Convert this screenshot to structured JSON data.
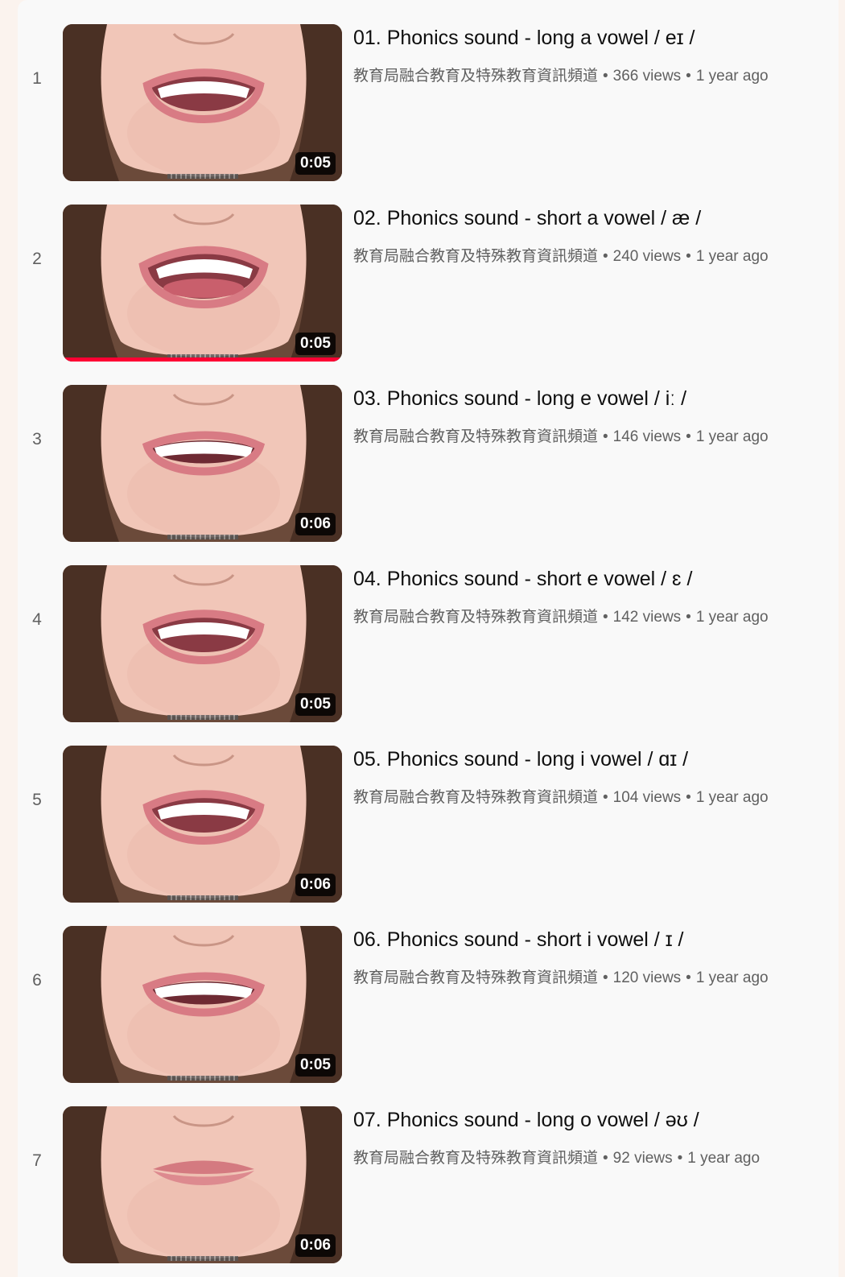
{
  "playlist": {
    "colors": {
      "progress": "#ff0033",
      "title": "#0f0f0f",
      "meta": "#606060"
    },
    "items": [
      {
        "index": "1",
        "title": "01. Phonics sound - long a vowel  / eɪ /",
        "channel": "教育局融合教育及特殊教育資訊頻道",
        "views": "366 views",
        "age": "1 year ago",
        "duration": "0:05",
        "watched_fraction": 0,
        "mouth": "open"
      },
      {
        "index": "2",
        "title": "02. Phonics sound - short a vowel  / æ  /",
        "channel": "教育局融合教育及特殊教育資訊頻道",
        "views": "240 views",
        "age": "1 year ago",
        "duration": "0:05",
        "watched_fraction": 1,
        "mouth": "wide"
      },
      {
        "index": "3",
        "title": "03. Phonics sound - long e vowel  / iː /",
        "channel": "教育局融合教育及特殊教育資訊頻道",
        "views": "146 views",
        "age": "1 year ago",
        "duration": "0:06",
        "watched_fraction": 0,
        "mouth": "smile"
      },
      {
        "index": "4",
        "title": "04. Phonics sound - short e vowel  / ɛ /",
        "channel": "教育局融合教育及特殊教育資訊頻道",
        "views": "142 views",
        "age": "1 year ago",
        "duration": "0:05",
        "watched_fraction": 0,
        "mouth": "open"
      },
      {
        "index": "5",
        "title": "05. Phonics sound - long i vowel  / ɑɪ /",
        "channel": "教育局融合教育及特殊教育資訊頻道",
        "views": "104 views",
        "age": "1 year ago",
        "duration": "0:06",
        "watched_fraction": 0,
        "mouth": "open"
      },
      {
        "index": "6",
        "title": "06. Phonics sound - short i vowel  / ɪ /",
        "channel": "教育局融合教育及特殊教育資訊頻道",
        "views": "120 views",
        "age": "1 year ago",
        "duration": "0:05",
        "watched_fraction": 0,
        "mouth": "smile"
      },
      {
        "index": "7",
        "title": "07. Phonics sound - long o vowel  / əʊ /",
        "channel": "教育局融合教育及特殊教育資訊頻道",
        "views": "92 views",
        "age": "1 year ago",
        "duration": "0:06",
        "watched_fraction": 0,
        "mouth": "closed"
      }
    ]
  }
}
